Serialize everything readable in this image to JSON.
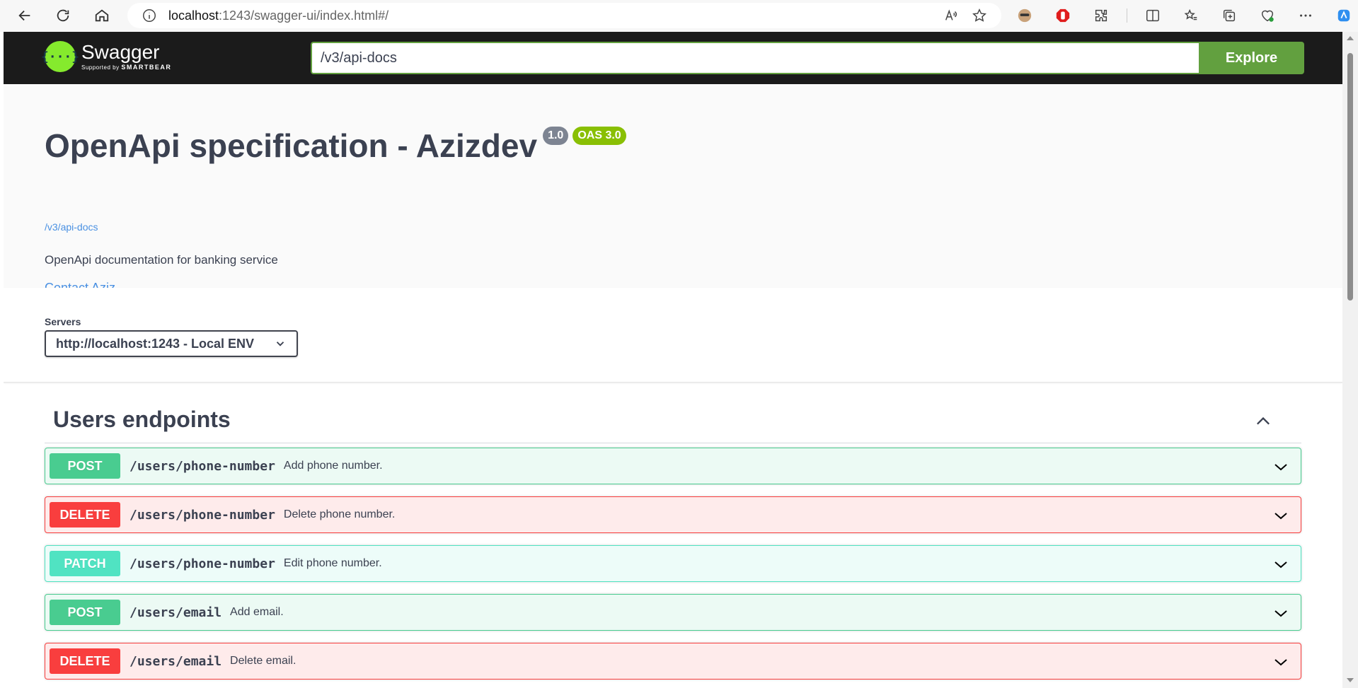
{
  "browser": {
    "url_host": "localhost",
    "url_path": ":1243/swagger-ui/index.html#/"
  },
  "topbar": {
    "logo_text": "Swagger",
    "logo_sub_prefix": "Supported by",
    "logo_sub_brand": "SMARTBEAR",
    "search_value": "/v3/api-docs",
    "explore_label": "Explore"
  },
  "info": {
    "title": "OpenApi specification - Azizdev",
    "version_badge": "1.0",
    "oas_badge": "OAS 3.0",
    "spec_link": "/v3/api-docs",
    "description": "OpenApi documentation for banking service",
    "contact_link": "Contact Aziz"
  },
  "servers": {
    "label": "Servers",
    "selected": "http://localhost:1243 - Local ENV"
  },
  "tag": {
    "title": "Users endpoints"
  },
  "operations": [
    {
      "method": "POST",
      "path": "/users/phone-number",
      "summary": "Add phone number."
    },
    {
      "method": "DELETE",
      "path": "/users/phone-number",
      "summary": "Delete phone number."
    },
    {
      "method": "PATCH",
      "path": "/users/phone-number",
      "summary": "Edit phone number."
    },
    {
      "method": "POST",
      "path": "/users/email",
      "summary": "Add email."
    },
    {
      "method": "DELETE",
      "path": "/users/email",
      "summary": "Delete email."
    }
  ],
  "colors": {
    "post": "#49cc90",
    "delete": "#f93e3e",
    "patch": "#50e3c2",
    "explore": "#62a03f",
    "topbar": "#1b1b1b"
  }
}
